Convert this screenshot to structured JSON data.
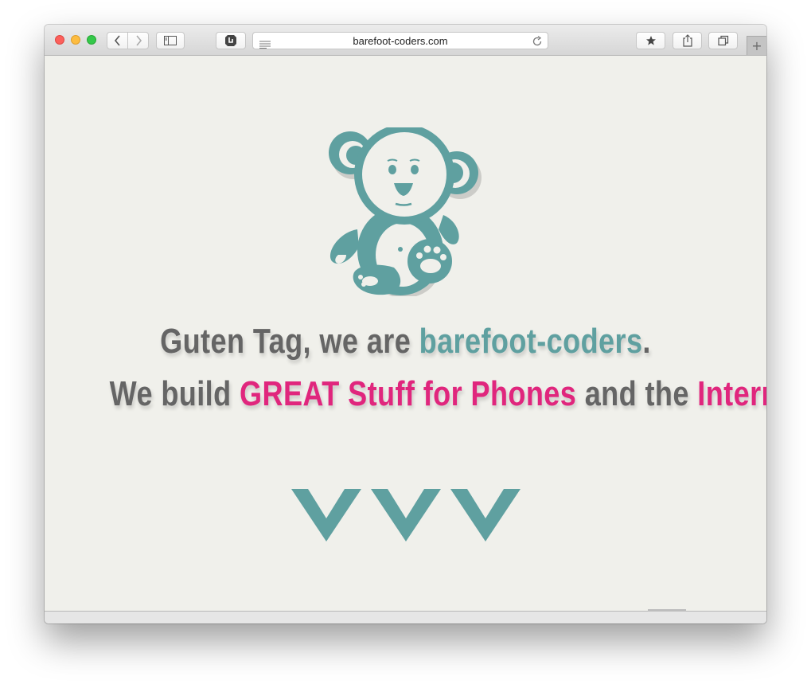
{
  "browser": {
    "url": "barefoot-coders.com",
    "icons": {
      "back": "chevron-left-icon",
      "forward": "chevron-right-icon",
      "sidebar": "sidebar-icon",
      "shield": "shield-icon",
      "reader": "reader-icon",
      "reload": "reload-icon",
      "bookmark": "star-icon",
      "share": "share-icon",
      "tabs": "tabs-overview-icon",
      "new_tab": "plus-icon"
    }
  },
  "page": {
    "line1": {
      "prefix": "Guten Tag, we are ",
      "brand": "barefoot-coders",
      "suffix": "."
    },
    "line2": {
      "part1": "We build ",
      "highlight1": "GREAT Stuff for Phones",
      "part2": " and the ",
      "highlight2": "Internet",
      "suffix": "."
    },
    "logo": "teddy-bear-logo",
    "scroll_indicator": "chevrons-down-icon"
  },
  "colors": {
    "teal": "#5fa0a0",
    "pink": "#e0267d",
    "text_gray": "#656565",
    "page_bg": "#f0f0eb"
  }
}
